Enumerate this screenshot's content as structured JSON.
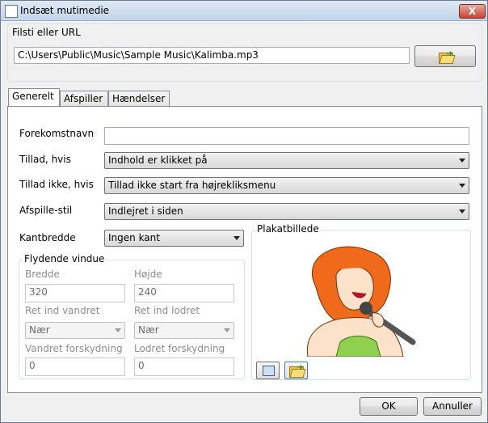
{
  "window": {
    "title": "Indsæt mutimedie",
    "close_symbol": "X"
  },
  "path_group": {
    "legend": "Filsti eller URL",
    "value": "C:\\Users\\Public\\Music\\Sample Music\\Kalimba.mp3",
    "browse_icon": "folder-open-icon"
  },
  "tabs": [
    {
      "label": "Generelt",
      "active": true
    },
    {
      "label": "Afspiller",
      "active": false
    },
    {
      "label": "Hændelser",
      "active": false
    }
  ],
  "general": {
    "instance_name_label": "Forekomstnavn",
    "instance_name_value": "",
    "allow_label": "Tillad, hvis",
    "allow_value": "Indhold er klikket på",
    "disallow_label": "Tillad ikke, hvis",
    "disallow_value": "Tillad ikke start fra højrekliksmenu",
    "play_style_label": "Afspille-stil",
    "play_style_value": "Indlejret i siden",
    "border_label": "Kantbredde",
    "border_value": "Ingen kant"
  },
  "floating": {
    "legend": "Flydende vindue",
    "width_label": "Bredde",
    "width_value": "320",
    "height_label": "Højde",
    "height_value": "240",
    "halign_label": "Ret ind vandret",
    "halign_value": "Nær",
    "valign_label": "Ret ind lodret",
    "valign_value": "Nær",
    "hoffset_label": "Vandret forskydning",
    "hoffset_value": "0",
    "voffset_label": "Lodret forskydning",
    "voffset_value": "0"
  },
  "poster": {
    "legend": "Plakatbillede",
    "image": "singer-illustration",
    "buttons": [
      "image-icon",
      "folder-open-icon"
    ]
  },
  "footer": {
    "ok": "OK",
    "cancel": "Annuller"
  }
}
